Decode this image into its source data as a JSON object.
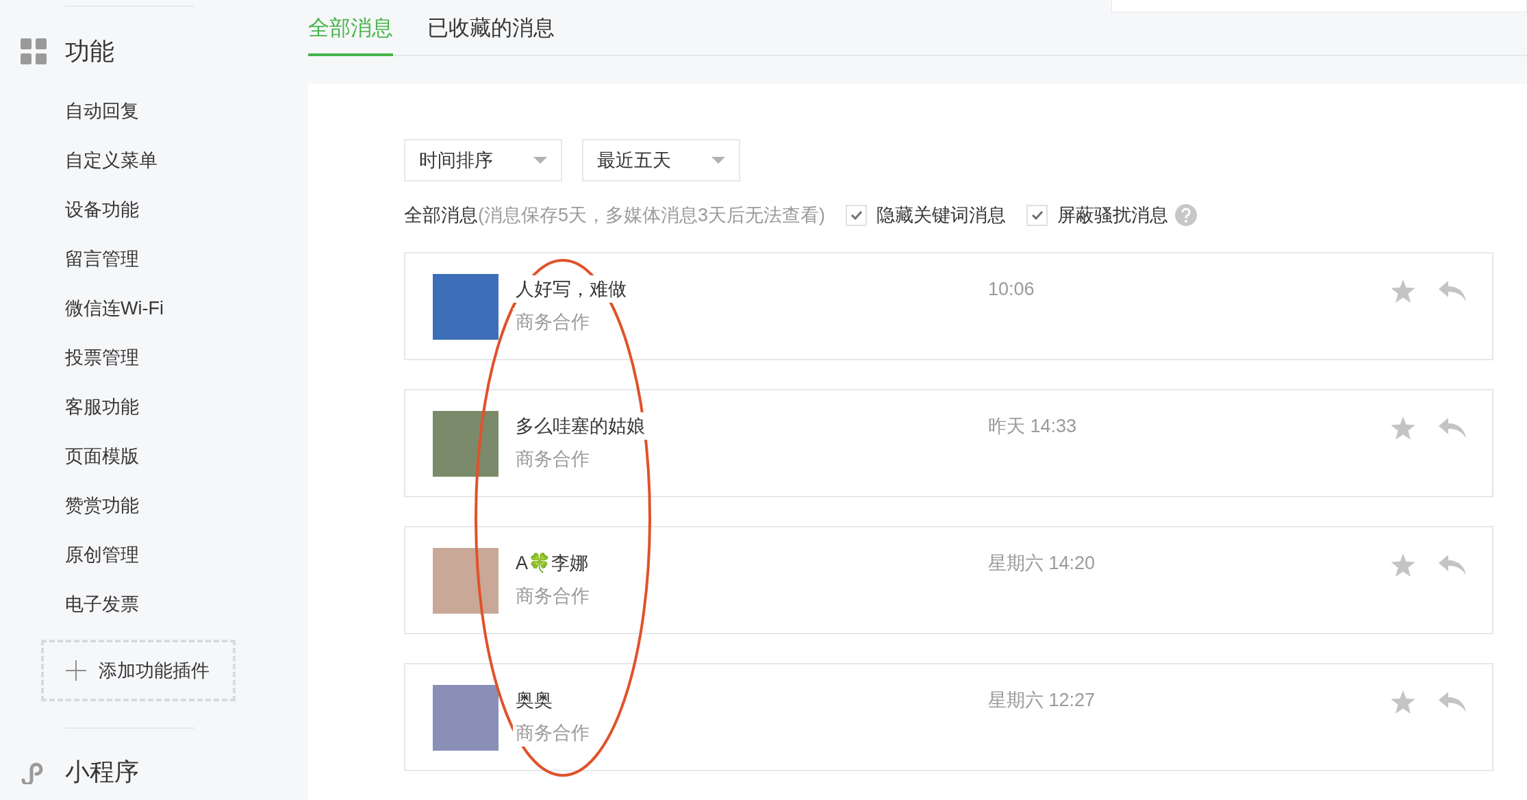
{
  "sidebar": {
    "section": {
      "title": "功能"
    },
    "items": [
      {
        "label": "自动回复"
      },
      {
        "label": "自定义菜单"
      },
      {
        "label": "设备功能"
      },
      {
        "label": "留言管理"
      },
      {
        "label": "微信连Wi-Fi"
      },
      {
        "label": "投票管理"
      },
      {
        "label": "客服功能"
      },
      {
        "label": "页面模版"
      },
      {
        "label": "赞赏功能"
      },
      {
        "label": "原创管理"
      },
      {
        "label": "电子发票"
      }
    ],
    "add_plugin": {
      "label": "添加功能插件"
    },
    "next_section": {
      "title": "小程序"
    }
  },
  "tabs": [
    {
      "label": "全部消息",
      "selected": true
    },
    {
      "label": "已收藏的消息",
      "selected": false
    }
  ],
  "filters": [
    {
      "label": "时间排序"
    },
    {
      "label": "最近五天"
    }
  ],
  "notice": {
    "title": "全部消息",
    "note": "(消息保存5天，多媒体消息3天后无法查看)"
  },
  "options": [
    {
      "label": "隐藏关键词消息",
      "checked": true
    },
    {
      "label": "屏蔽骚扰消息",
      "checked": true,
      "help": true
    }
  ],
  "messages": [
    {
      "name": "人好写，难做",
      "tag": "商务合作",
      "time": "10:06",
      "color": "#3d6fb8"
    },
    {
      "name": "多么哇塞的姑娘",
      "tag": "商务合作",
      "time": "昨天 14:33",
      "color": "#7a8a6a"
    },
    {
      "name": "A🍀李娜",
      "tag": "商务合作",
      "time": "星期六 14:20",
      "color": "#c9a898"
    },
    {
      "name": "奥奥",
      "tag": "商务合作",
      "time": "星期六 12:27",
      "color": "#8a8fb8"
    }
  ]
}
